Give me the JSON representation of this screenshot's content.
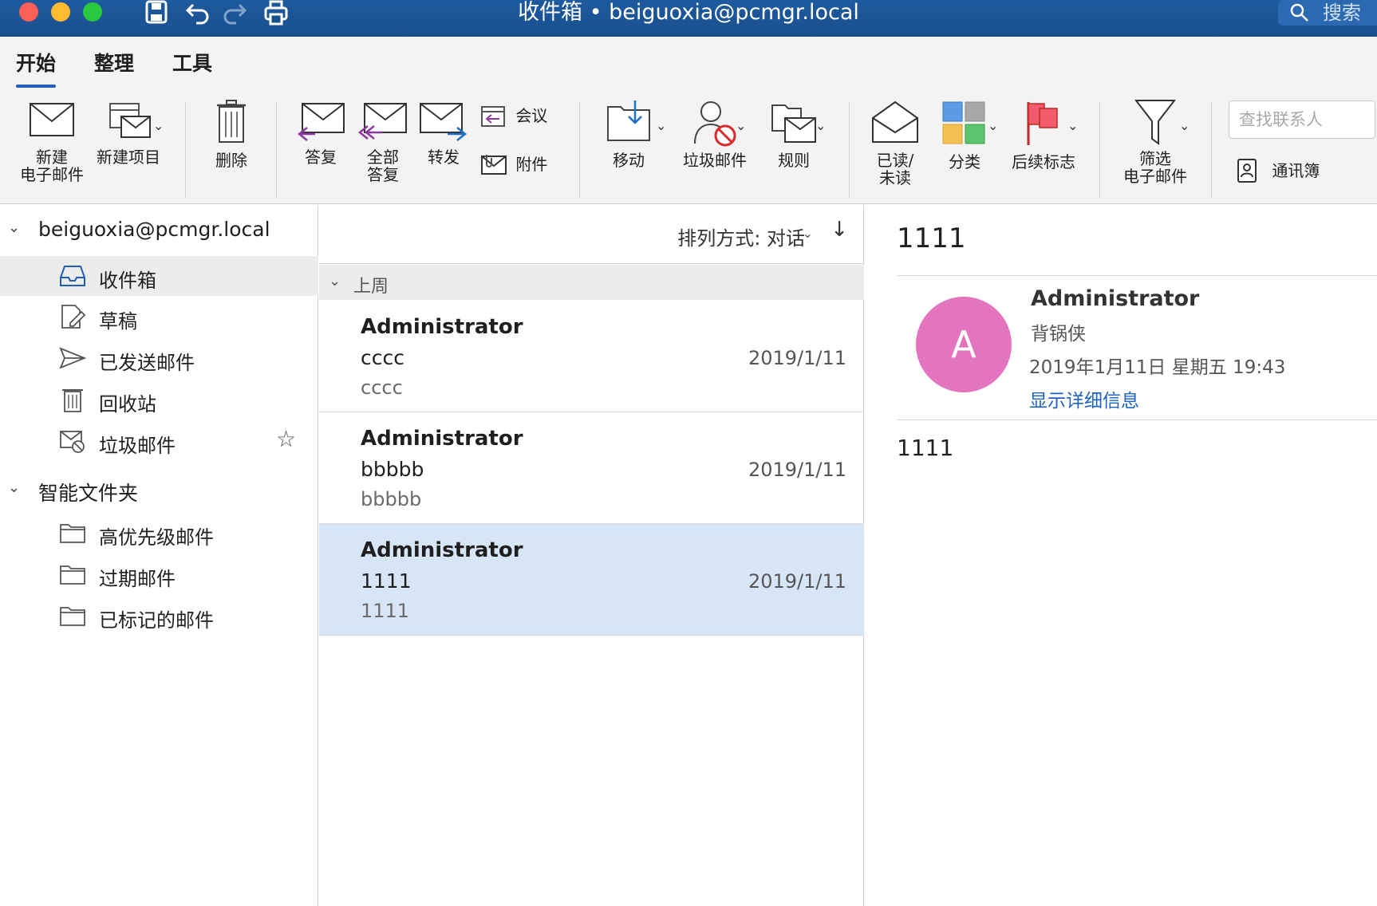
{
  "window": {
    "title": "收件箱 • beiguoxia@pcmgr.local",
    "search_label": "搜索"
  },
  "ribbon_tabs": [
    {
      "label": "开始",
      "active": true
    },
    {
      "label": "整理",
      "active": false
    },
    {
      "label": "工具",
      "active": false
    }
  ],
  "ribbon": {
    "new_email": [
      "新建",
      "电子邮件"
    ],
    "new_item": "新建项目",
    "delete": "删除",
    "reply": "答复",
    "reply_all": [
      "全部",
      "答复"
    ],
    "forward": "转发",
    "meeting": "会议",
    "attachment": "附件",
    "move": "移动",
    "junk": "垃圾邮件",
    "rules": "规则",
    "read_unread": [
      "已读/",
      "未读"
    ],
    "categorize": "分类",
    "follow_up": "后续标志",
    "filter_email": [
      "筛选",
      "电子邮件"
    ],
    "contact_search_placeholder": "查找联系人",
    "address_book": "通讯簿"
  },
  "sidebar": {
    "account": "beiguoxia@pcmgr.local",
    "folders": [
      {
        "label": "收件箱",
        "icon": "inbox-icon",
        "selected": true
      },
      {
        "label": "草稿",
        "icon": "drafts-icon",
        "selected": false
      },
      {
        "label": "已发送邮件",
        "icon": "sent-icon",
        "selected": false
      },
      {
        "label": "回收站",
        "icon": "trash-icon",
        "selected": false
      },
      {
        "label": "垃圾邮件",
        "icon": "junk-icon",
        "selected": false
      }
    ],
    "smart_folders_title": "智能文件夹",
    "smart_folders": [
      {
        "label": "高优先级邮件",
        "icon": "folder-icon"
      },
      {
        "label": "过期邮件",
        "icon": "folder-icon"
      },
      {
        "label": "已标记的邮件",
        "icon": "folder-icon"
      }
    ]
  },
  "message_list": {
    "sort_label": "排列方式: 对话",
    "group_label": "上周",
    "messages": [
      {
        "from": "Administrator",
        "subject": "cccc",
        "preview": "cccc",
        "date": "2019/1/11",
        "selected": false
      },
      {
        "from": "Administrator",
        "subject": "bbbbb",
        "preview": "bbbbb",
        "date": "2019/1/11",
        "selected": false
      },
      {
        "from": "Administrator",
        "subject": "1111",
        "preview": "1111",
        "date": "2019/1/11",
        "selected": true
      }
    ]
  },
  "reading_pane": {
    "subject": "1111",
    "avatar_letter": "A",
    "avatar_color": "#e374c0",
    "sender": "Administrator",
    "sender_alias": "背锅侠",
    "datetime": "2019年1月11日 星期五 19:43",
    "details_link": "显示详细信息",
    "body": "1111"
  },
  "colors": {
    "titlebar": "#1a4f8d",
    "accent": "#1f5fb8",
    "selected_row": "#d7e6f6",
    "link": "#1e63c2"
  }
}
